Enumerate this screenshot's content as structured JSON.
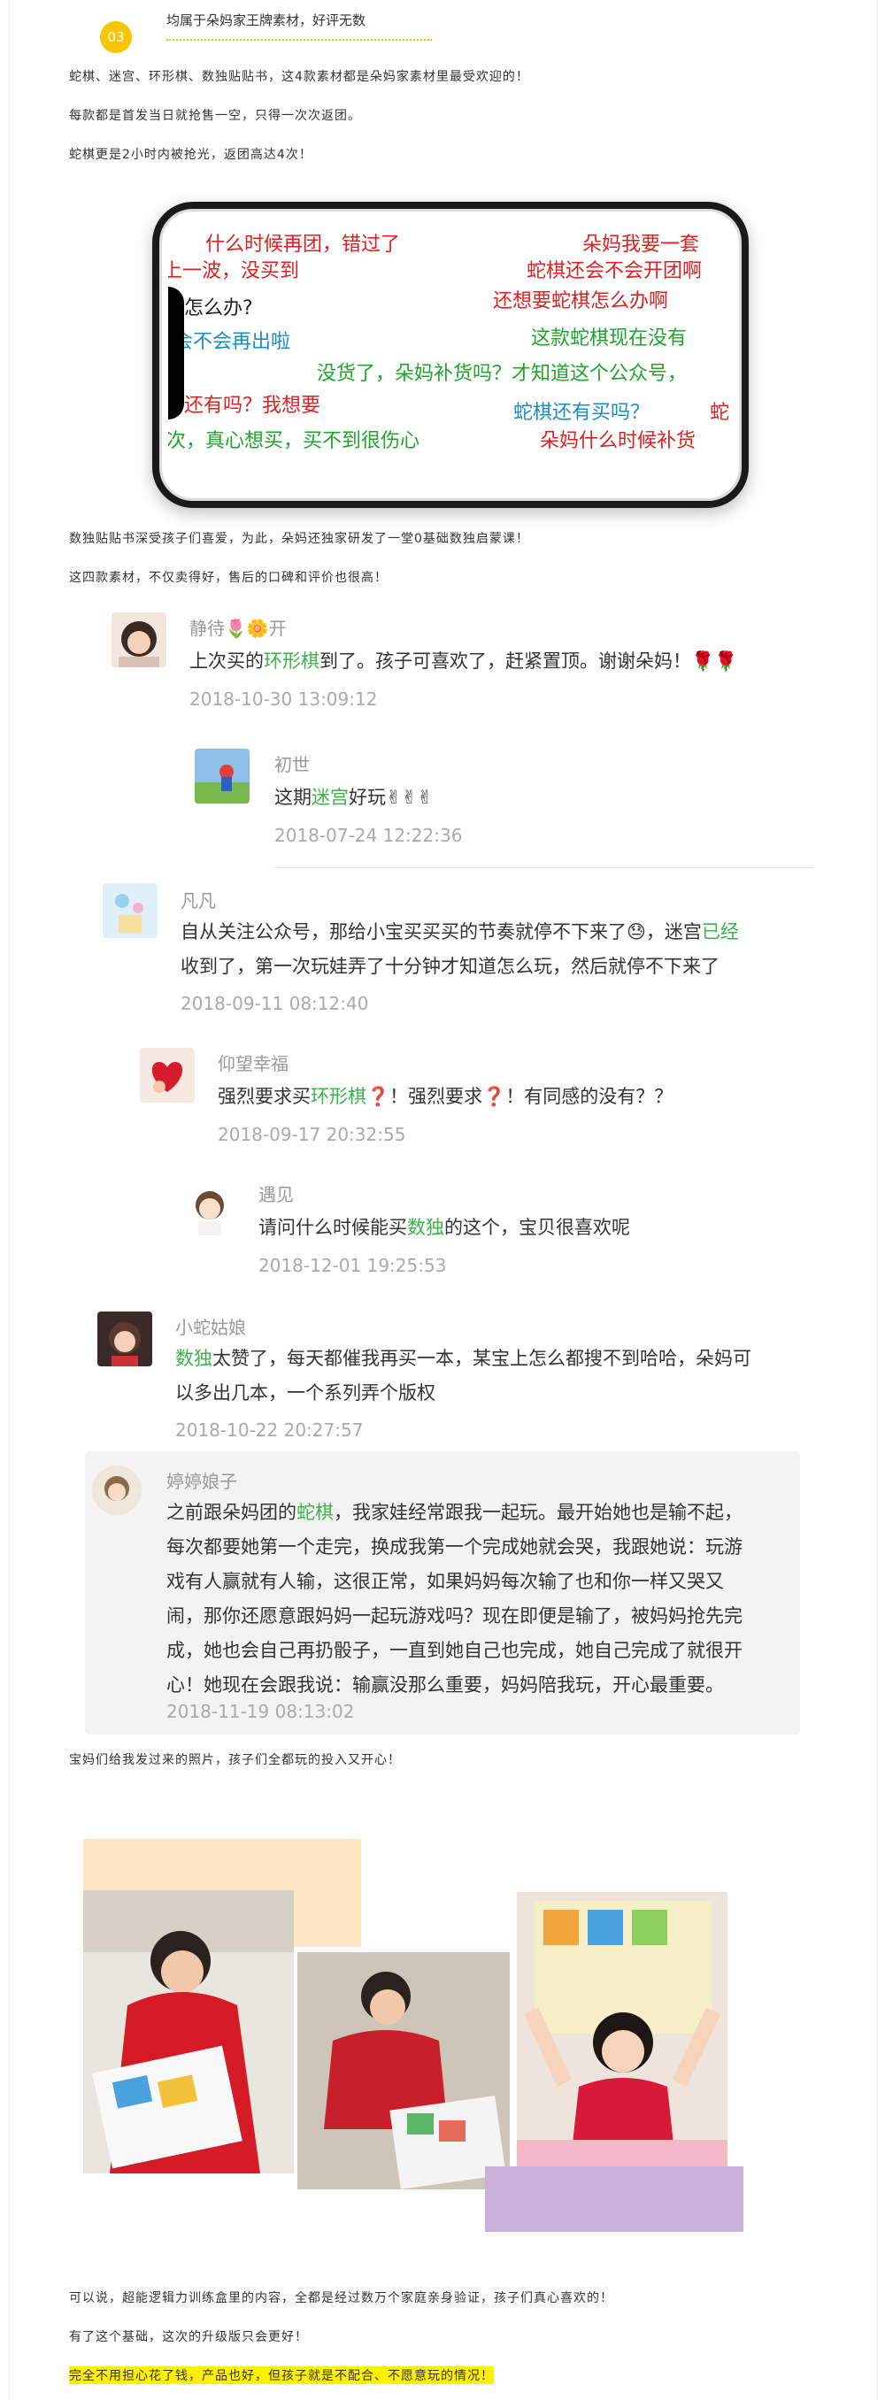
{
  "header": {
    "number": "03",
    "text": "均属于朵妈家王牌素材，好评无数"
  },
  "intro": [
    "蛇棋、迷宫、环形棋、数独贴贴书，这4款素材都是朵妈家素材里最受欢迎的！",
    "每款都是首发当日就抢售一空，只得一次次返团。",
    "蛇棋更是2小时内被抢光，返团高达4次！"
  ],
  "phone_danmaku": [
    {
      "text": "什么时候再团，错过了",
      "color": "red"
    },
    {
      "text": "朵妈我要一套",
      "color": "red"
    },
    {
      "text": "上一波，没买到",
      "color": "red"
    },
    {
      "text": "蛇棋还会不会开团啊",
      "color": "red"
    },
    {
      "text": "怎么办?",
      "color": "black"
    },
    {
      "text": "还想要蛇棋怎么办啊",
      "color": "red"
    },
    {
      "text": "这款蛇棋现在没有",
      "color": "green"
    },
    {
      "text": "会不会再出啦",
      "color": "blue"
    },
    {
      "text": "没货了，朵妈补货吗？才知道这个公众号，",
      "color": "green"
    },
    {
      "text": "还有吗？我想要",
      "color": "red"
    },
    {
      "text": "蛇棋还有买吗？",
      "color": "blue"
    },
    {
      "text": "蛇",
      "color": "red"
    },
    {
      "text": "次，真心想买，买不到很伤心",
      "color": "green"
    },
    {
      "text": "朵妈什么时候补货",
      "color": "red"
    }
  ],
  "mid": [
    "数独贴贴书深受孩子们喜爱，为此，朵妈还独家研发了一堂0基础数独启蒙课！",
    "这四款素材，不仅卖得好，售后的口碑和评价也很高！"
  ],
  "comments": [
    {
      "name": "静待🌷🌼开",
      "pre": "上次买的",
      "hl": "环形棋",
      "post": "到了。孩子可喜欢了，赶紧置顶。谢谢朵妈！🌹🌹",
      "date": "2018-10-30 13:09:12"
    },
    {
      "name": "初世",
      "pre": "这期",
      "hl": "迷宫",
      "post": "好玩✌✌✌",
      "date": "2018-07-24 12:22:36"
    },
    {
      "name": "凡凡",
      "line1_pre": "自从关注公众号，那给小宝买买买的节奏就停不下来了😓，迷宫",
      "line1_hl": "已经",
      "line2": "收到了，第一次玩娃弄了十分钟才知道怎么玩，然后就停不下来了",
      "date": "2018-09-11 08:12:40"
    },
    {
      "name": "仰望幸福",
      "pre": "强烈要求买",
      "hl": "环形棋",
      "mark1": "❓",
      "mid": "！强烈要求",
      "mark2": "❓",
      "post": "！有同感的没有？？",
      "date": "2018-09-17 20:32:55"
    },
    {
      "name": "遇见",
      "pre": "请问什么时候能买",
      "hl": "数独",
      "post": "的这个，宝贝很喜欢呢",
      "date": "2018-12-01 19:25:53"
    },
    {
      "name": "小蛇姑娘",
      "hl": "数独",
      "line1_post": "太赞了，每天都催我再买一本，某宝上怎么都搜不到哈哈，朵妈可",
      "line2": "以多出几本，一个系列弄个版权",
      "date": "2018-10-22 20:27:57"
    },
    {
      "name": "婷婷娘子",
      "pre": "之前跟朵妈团的",
      "hl": "蛇棋",
      "line1_post": "，我家娃经常跟我一起玩。最开始她也是输不起，",
      "lines": [
        "每次都要她第一个走完，换成我第一个完成她就会哭，我跟她说：玩游",
        "戏有人赢就有人输，这很正常，如果妈妈每次输了也和你一样又哭又",
        "闹，那你还愿意跟妈妈一起玩游戏吗？现在即便是输了，被妈妈抢先完",
        "成，她也会自己再扔骰子，一直到她自己也完成，她自己完成了就很开",
        "心！她现在会跟我说：输赢没那么重要，妈妈陪我玩，开心最重要。"
      ],
      "date": "2018-11-19 08:13:02"
    }
  ],
  "photos_caption": "宝妈们给我发过来的照片，孩子们全都玩的投入又开心！",
  "outro": [
    "可以说，超能逻辑力训练盒里的内容，全都是经过数万个家庭亲身验证，孩子们真心喜欢的！",
    "有了这个基础，这次的升级版只会更好！",
    "完全不用担心花了钱，产品也好，但孩子就是不配合、不愿意玩的情况！"
  ],
  "colors": {
    "accent": "#f7c600",
    "green_highlight": "#3ab44a",
    "yellow_highlight": "#fff000"
  }
}
